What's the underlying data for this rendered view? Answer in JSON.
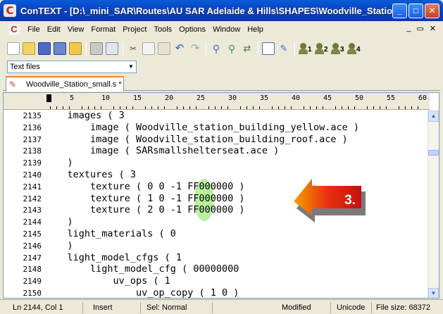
{
  "window": {
    "title": "ConTEXT - [D:\\_mini_SAR\\Routes\\AU SAR Adelaide & Hills\\SHAPES\\Woodville_Station...",
    "app_icon": "C",
    "buttons": {
      "minimize": "_",
      "maximize": "□",
      "close": "✕"
    }
  },
  "menu": {
    "items": [
      "File",
      "Edit",
      "View",
      "Format",
      "Project",
      "Tools",
      "Options",
      "Window",
      "Help"
    ],
    "mdi_buttons": [
      "_",
      "▭",
      "✕"
    ]
  },
  "toolbar": {
    "icons": [
      "new-file-icon",
      "open-icon",
      "save-icon",
      "save-all-icon",
      "open-folder-icon",
      "print-icon",
      "print-preview-icon",
      "cut-icon",
      "copy-icon",
      "paste-icon",
      "undo-icon",
      "redo-icon",
      "find-icon",
      "find-next-icon",
      "replace-icon",
      "output-icon",
      "tools-icon",
      "user-1-icon",
      "user-2-icon",
      "user-3-icon",
      "user-4-icon"
    ],
    "user_numbers": [
      "1",
      "2",
      "3",
      "4"
    ]
  },
  "filter": {
    "selected": "Text files"
  },
  "tabs": [
    {
      "label": "Woodville_Station_small.s *"
    }
  ],
  "ruler": {
    "marks": [
      "5",
      "10",
      "15",
      "20",
      "25",
      "30",
      "35",
      "40",
      "45",
      "50",
      "55",
      "60"
    ]
  },
  "editor": {
    "lines": [
      {
        "no": "2135",
        "text": "    images ( 3"
      },
      {
        "no": "2136",
        "text": "        image ( Woodville_station_building_yellow.ace )"
      },
      {
        "no": "2137",
        "text": "        image ( Woodville_station_building_roof.ace )"
      },
      {
        "no": "2138",
        "text": "        image ( SARsmallshelterseat.ace )"
      },
      {
        "no": "2139",
        "text": "    )"
      },
      {
        "no": "2140",
        "text": "    textures ( 3"
      },
      {
        "no": "2141",
        "text": "        texture ( 0 0 -1 FF000000 )"
      },
      {
        "no": "2142",
        "text": "        texture ( 1 0 -1 FF000000 )"
      },
      {
        "no": "2143",
        "text": "        texture ( 2 0 -1 FF000000 )"
      },
      {
        "no": "2144",
        "text": "    )"
      },
      {
        "no": "2145",
        "text": "    light_materials ( 0"
      },
      {
        "no": "2146",
        "text": "    )"
      },
      {
        "no": "2147",
        "text": "    light_model_cfgs ( 1"
      },
      {
        "no": "2148",
        "text": "        light_model_cfg ( 00000000"
      },
      {
        "no": "2149",
        "text": "            uv_ops ( 1"
      },
      {
        "no": "2150",
        "text": "                uv_op_copy ( 1 0 )"
      }
    ]
  },
  "annotation": {
    "label": "3."
  },
  "status": {
    "position": "Ln 2144, Col 1",
    "mode": "Insert",
    "selection": "Sel: Normal",
    "modified": "Modified",
    "encoding": "Unicode",
    "file_size": "File size: 68372"
  }
}
